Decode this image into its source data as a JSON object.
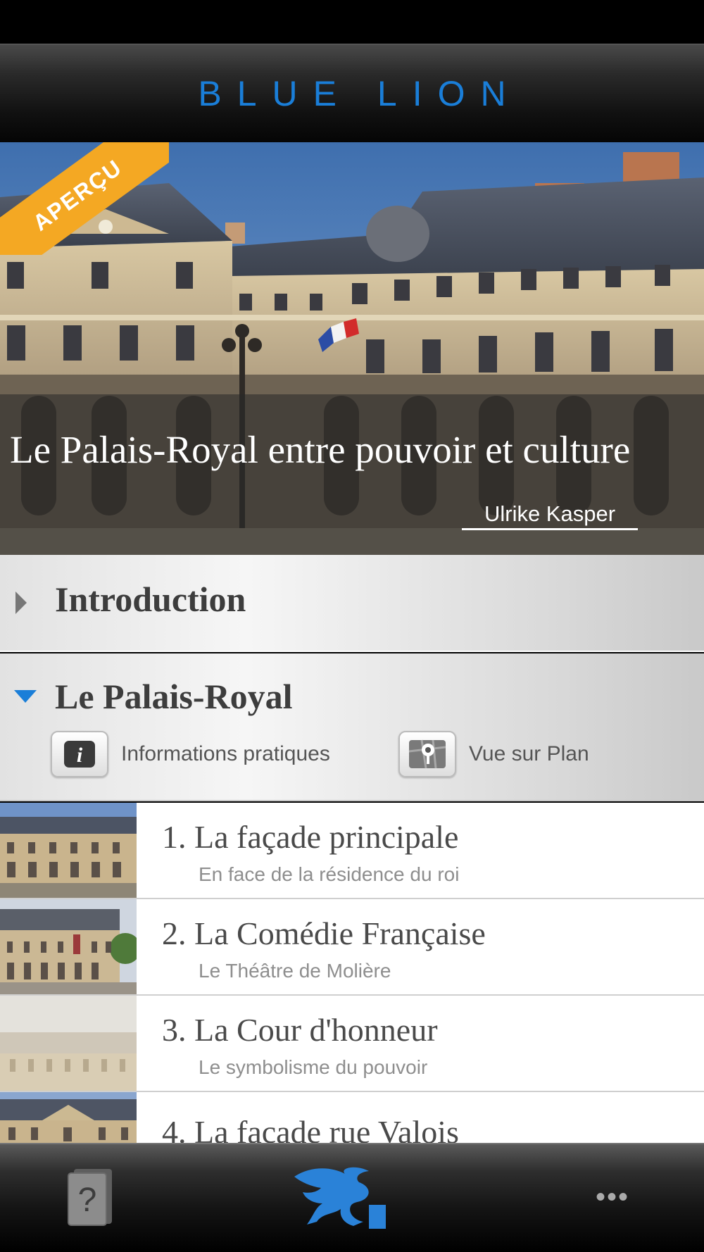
{
  "header": {
    "brand": "BLUE LION"
  },
  "hero": {
    "badge": "APERÇU",
    "title": "Le Palais-Royal entre pouvoir et culture",
    "author": "Ulrike Kasper"
  },
  "sections": {
    "introduction": {
      "title": "Introduction",
      "expanded": false
    },
    "palais": {
      "title": "Le Palais-Royal",
      "expanded": true,
      "info_label": "Informations pratiques",
      "map_label": "Vue sur Plan"
    }
  },
  "stops": [
    {
      "title": "1. La façade principale",
      "subtitle": "En face de la résidence du roi"
    },
    {
      "title": "2. La Comédie Française",
      "subtitle": "Le Théâtre de Molière"
    },
    {
      "title": "3. La Cour d'honneur",
      "subtitle": "Le symbolisme du pouvoir"
    },
    {
      "title": "4. La façade rue Valois",
      "subtitle": ""
    }
  ],
  "tabbar": {
    "help_icon": "help-book-icon",
    "home_icon": "blue-lion-logo-icon",
    "more_label": "•••"
  },
  "colors": {
    "accent": "#1a7ed8",
    "badge": "#f4a823"
  }
}
